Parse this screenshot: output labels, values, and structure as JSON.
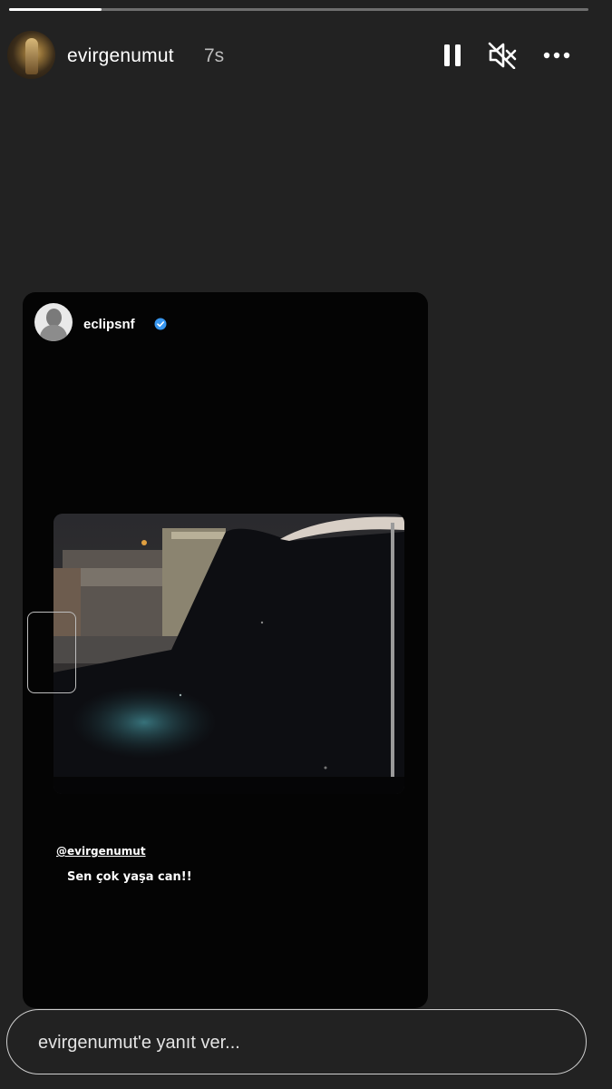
{
  "story": {
    "username": "evirgenumut",
    "time": "7s",
    "progress": 0.16
  },
  "controls": {
    "pause_icon": "pause-icon",
    "mute_icon": "muted-speaker-icon",
    "more_icon": "more-options-icon"
  },
  "shared_post": {
    "username": "eclipsnf",
    "verified_icon": "verified-badge-icon",
    "mention": "@evirgenumut",
    "caption": "Sen çok yaşa can!!"
  },
  "reply": {
    "placeholder": "evirgenumut'e yanıt ver..."
  },
  "colors": {
    "background": "#222222",
    "card": "#040404",
    "verified": "#3897f0"
  }
}
